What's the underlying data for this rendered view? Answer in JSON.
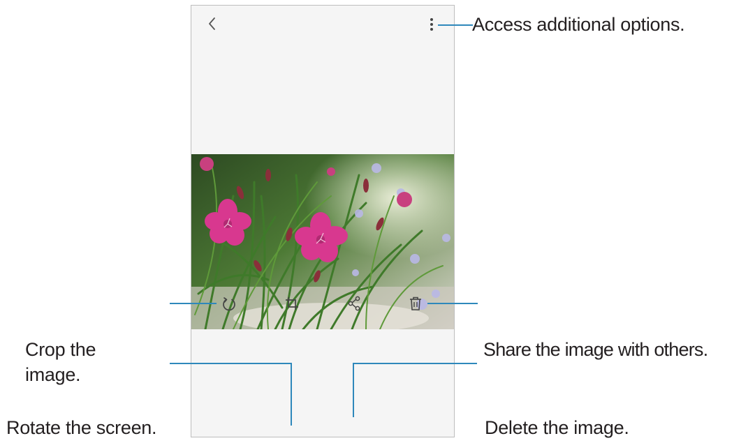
{
  "callouts": {
    "more_options": "Access additional options.",
    "crop_line1": "Crop the",
    "crop_line2": "image.",
    "share": "Share the image with others.",
    "rotate": "Rotate the screen.",
    "delete": "Delete the image."
  },
  "icons": {
    "back": "chevron-left-icon",
    "more": "more-vertical-icon",
    "rotate": "rotate-icon",
    "crop": "crop-icon",
    "share": "share-icon",
    "delete": "trash-icon"
  },
  "colors": {
    "callout_line": "#2e88bb",
    "screen_bg": "#f5f5f5",
    "flower": "#d8388f"
  }
}
